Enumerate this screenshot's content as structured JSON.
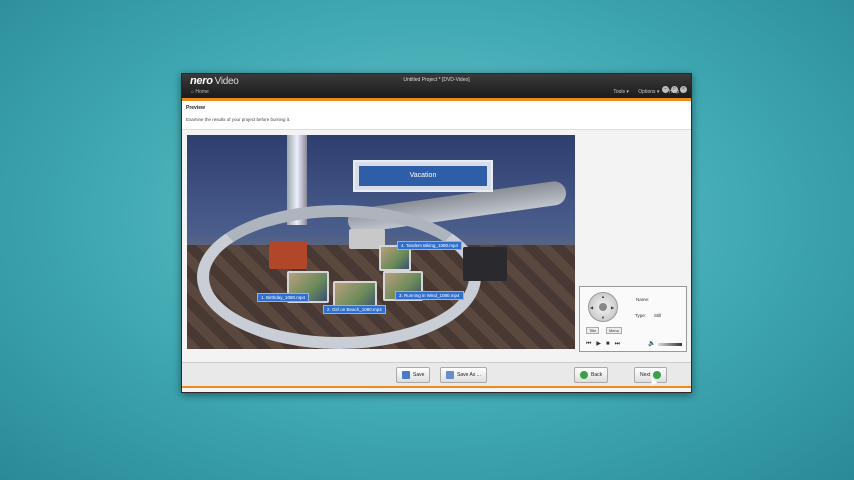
{
  "window": {
    "logo": "nero",
    "product": "Video",
    "title": "Untitled Project * [DVD-Video]",
    "home": "Home",
    "controls": [
      "–",
      "□",
      "×"
    ]
  },
  "menu": {
    "tools": "Tools ▾",
    "options": "Options ▾",
    "help": "Help ▾"
  },
  "page": {
    "title": "Preview",
    "subtitle": "Examine the results of your project before burning it."
  },
  "preview": {
    "sign_text": "Vacation",
    "chapters": [
      "1. Birthday_1080.mp4",
      "2. Girl on Beach_1080.mp4",
      "3. Running in Wind_1080.mp4",
      "4. Tandem Biking_1080.mp4"
    ]
  },
  "remote": {
    "name_label": "Name:",
    "name_value": "",
    "type_label": "Type:",
    "type_value": "Still",
    "title_btn": "Title",
    "menu_btn": "Menu"
  },
  "footer": {
    "save": "Save",
    "save_as": "Save As ...",
    "back": "Back",
    "next": "Next"
  },
  "colors": {
    "accent": "#f08a1c",
    "label_bg": "#2f6fd0",
    "sign_bg": "#2f5ea8"
  }
}
